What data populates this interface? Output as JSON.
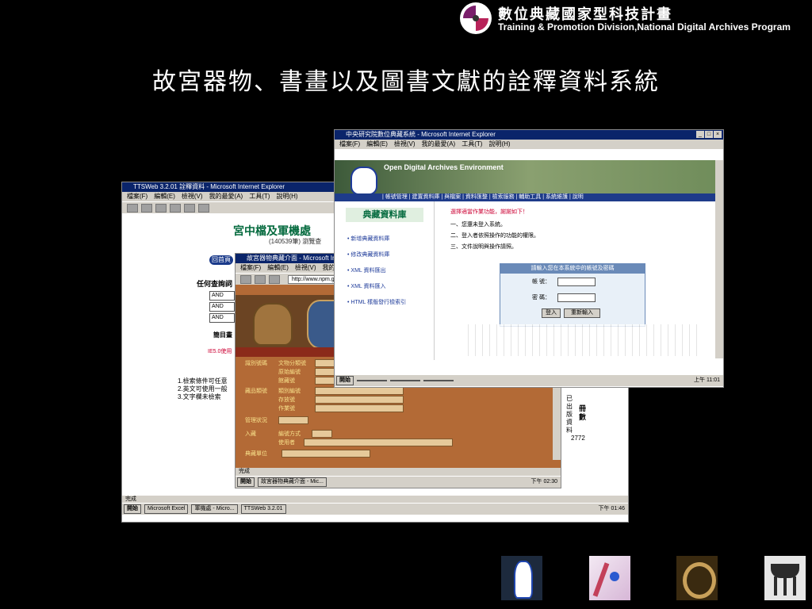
{
  "logo": {
    "cn": "數位典藏國家型科技計畫",
    "en": "Training & Promotion Division,National Digital Archives Program"
  },
  "slide": {
    "title": "故宮器物、書畫以及圖書文獻的詮釋資料系統"
  },
  "window1": {
    "title": "TTSWeb 3.2.01 詮釋資料 - Microsoft Internet Explorer",
    "menu": [
      "檔案(F)",
      "編輯(E)",
      "檢視(V)",
      "我的最愛(A)",
      "工具(T)",
      "說明(H)"
    ],
    "heading": "宮中檔及軍機處",
    "subheading": "(140539筆)  瀏覽查",
    "tab": "回首頁",
    "query_label": "任何查詢詞",
    "selects": [
      "AND",
      "AND",
      "AND"
    ],
    "mid_label": "簡目畫",
    "note": "IE5.0使用",
    "list": [
      "1.檢索條件可任意",
      "2.英文可使用一般",
      "3.文字欄未檢索"
    ],
    "side_text": "已出版資料",
    "side_bold": "冊數",
    "side_num": "2772",
    "status": "完成",
    "taskbar": [
      "開始",
      "Microsoft Excel",
      "軍機處 - Micro...",
      "TTSWeb 3.2.01"
    ],
    "clock": "下午 01:46"
  },
  "window2": {
    "title": "故宮器物典藏介面 - Microsoft Internet Explorer",
    "menu": [
      "檔案(F)",
      "編輯(E)",
      "檢視(V)",
      "我的最愛(A)"
    ],
    "address": "http://www.npm.gov.tw",
    "rows": [
      "文物分類號",
      "原始編號",
      "館藏號",
      "類別編號",
      "存放號",
      "作業號",
      "編號方式",
      "使用者",
      "典藏單位"
    ],
    "labels": [
      "識別號碼",
      "藏品類號",
      "管理狀況",
      "入藏",
      "典藏單位"
    ],
    "status": "完成",
    "taskbar": [
      "開始",
      "故宮器物典藏介面 - Mic..."
    ],
    "clock": "下午 02:30"
  },
  "window3": {
    "title": "中央研究院數位典藏系統 - Microsoft Internet Explorer",
    "menu": [
      "檔案(F)",
      "編輯(E)",
      "檢視(V)",
      "我的最愛(A)",
      "工具(T)",
      "說明(H)"
    ],
    "logo": "Open Digital Archives Environment",
    "nav": "| 帳號管理 | 建置資料庫 | 與檔案 | 資料匯整 | 檢索服務 | 輔助工具 | 系統維護 | 說明",
    "side_title": "典藏資料庫",
    "side_items": [
      "• 新增典藏資料庫",
      "• 修改典藏資料庫",
      "• XML 資料匯出",
      "• XML 資料匯入",
      "• HTML 樣版發行檢索引"
    ],
    "note": "選擇適當作業功能，謝謝如下！",
    "steps": [
      "一、您還未登入系統。",
      "二、登入者依照操作的功能的權限。",
      "三、文件說明與操作請照。"
    ],
    "login_head": "請輸入您在本系統中的帳號及密碼",
    "login_user": "帳  號：",
    "login_pass": "密  碼：",
    "login_btn": "登入",
    "reset_btn": "重新輸入",
    "taskbar": [
      "開始"
    ],
    "clock": "上午 11:01"
  }
}
